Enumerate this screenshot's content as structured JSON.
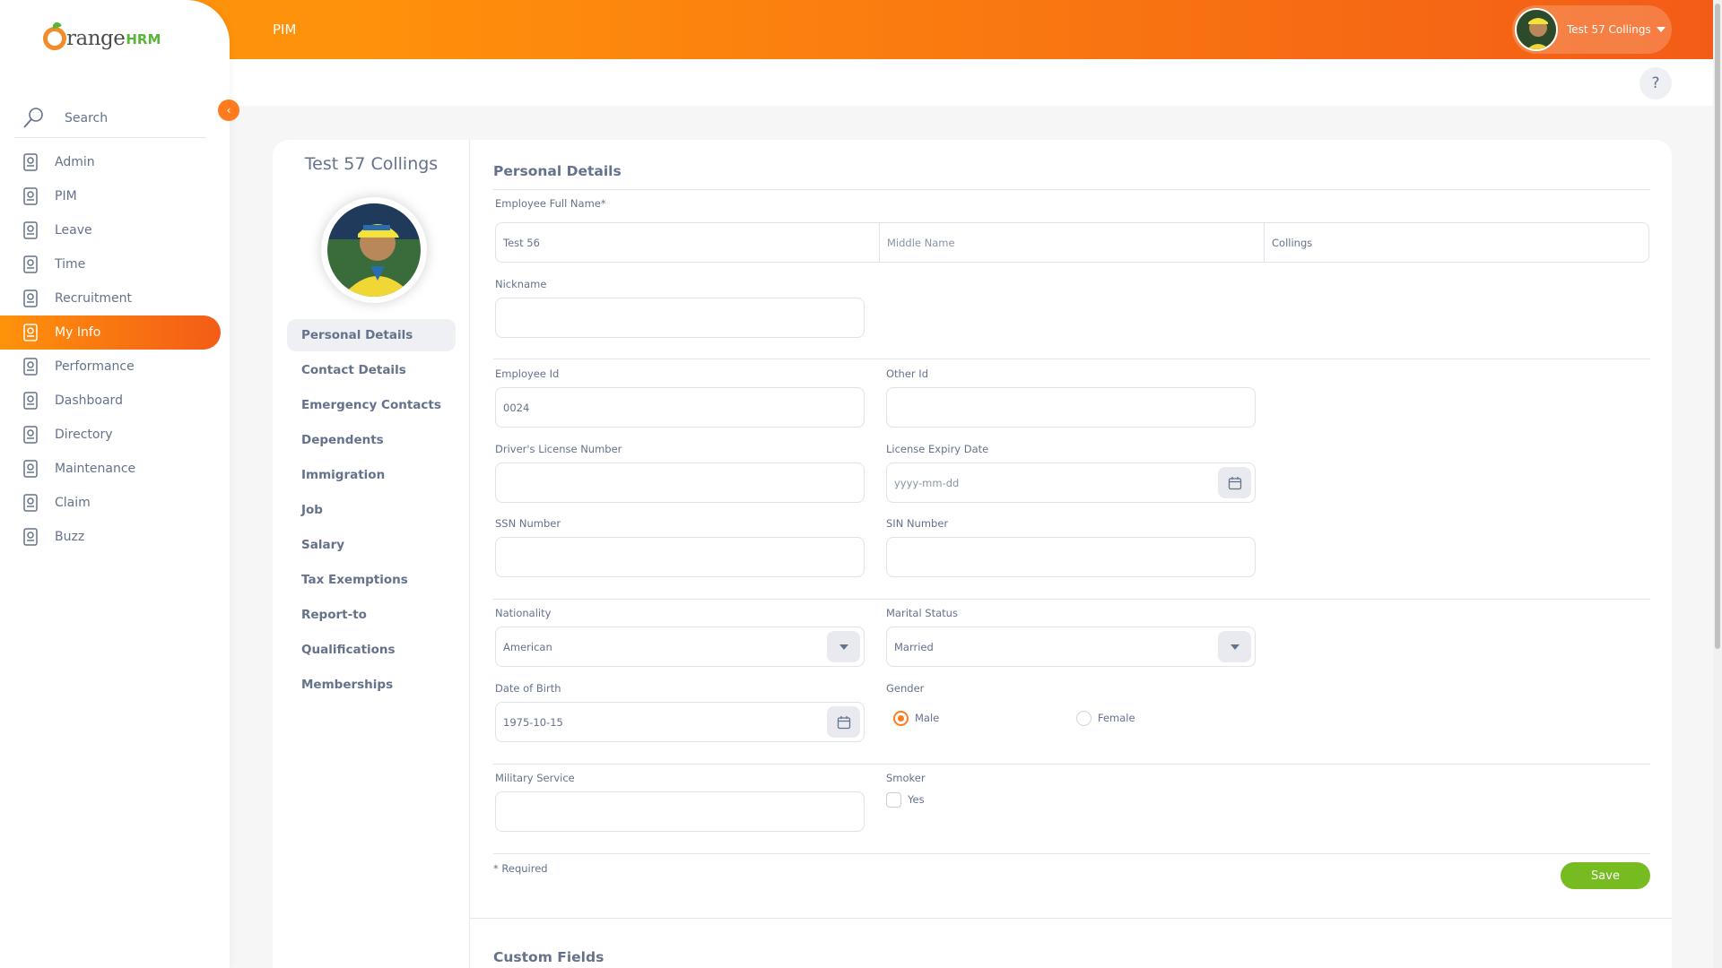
{
  "brand": {
    "name": "range",
    "suffix": "HRM"
  },
  "topbar": {
    "module_title": "PIM",
    "user_name": "Test 57 Collings"
  },
  "help": {
    "label": "?"
  },
  "sidebar": {
    "search_label": "Search",
    "items": [
      {
        "label": "Admin",
        "icon": "admin-icon"
      },
      {
        "label": "PIM",
        "icon": "pim-icon"
      },
      {
        "label": "Leave",
        "icon": "leave-icon"
      },
      {
        "label": "Time",
        "icon": "time-icon"
      },
      {
        "label": "Recruitment",
        "icon": "recruitment-icon"
      },
      {
        "label": "My Info",
        "icon": "my-info-icon"
      },
      {
        "label": "Performance",
        "icon": "performance-icon"
      },
      {
        "label": "Dashboard",
        "icon": "dashboard-icon"
      },
      {
        "label": "Directory",
        "icon": "directory-icon"
      },
      {
        "label": "Maintenance",
        "icon": "maintenance-icon"
      },
      {
        "label": "Claim",
        "icon": "claim-icon"
      },
      {
        "label": "Buzz",
        "icon": "buzz-icon"
      }
    ]
  },
  "profile": {
    "employee_name": "Test 57 Collings",
    "tabs": [
      "Personal Details",
      "Contact Details",
      "Emergency Contacts",
      "Dependents",
      "Immigration",
      "Job",
      "Salary",
      "Tax Exemptions",
      "Report-to",
      "Qualifications",
      "Memberships"
    ]
  },
  "form": {
    "section_title": "Personal Details",
    "full_name_label": "Employee Full Name*",
    "first_name": "Test 56",
    "middle_name_placeholder": "Middle Name",
    "last_name": "Collings",
    "nickname_label": "Nickname",
    "nickname_value": "",
    "employee_id_label": "Employee Id",
    "employee_id_value": "0024",
    "other_id_label": "Other Id",
    "other_id_value": "",
    "drivers_license_label": "Driver's License Number",
    "license_expiry_label": "License Expiry Date",
    "license_expiry_placeholder": "yyyy-mm-dd",
    "ssn_label": "SSN Number",
    "sin_label": "SIN Number",
    "nationality_label": "Nationality",
    "nationality_value": "American",
    "marital_status_label": "Marital Status",
    "marital_status_value": "Married",
    "dob_label": "Date of Birth",
    "dob_value": "1975-10-15",
    "gender_label": "Gender",
    "gender_options": [
      "Male",
      "Female"
    ],
    "gender_selected": "Male",
    "military_label": "Military Service",
    "smoker_label": "Smoker",
    "smoker_option": "Yes",
    "required_note": "* Required",
    "save_label": "Save"
  },
  "custom_fields": {
    "title": "Custom Fields"
  },
  "colors": {
    "accent": "#ff7b1d",
    "gradient_start": "#ff920b",
    "gradient_end": "#f35c17",
    "save_green": "#76bc21",
    "text": "#64728c"
  }
}
